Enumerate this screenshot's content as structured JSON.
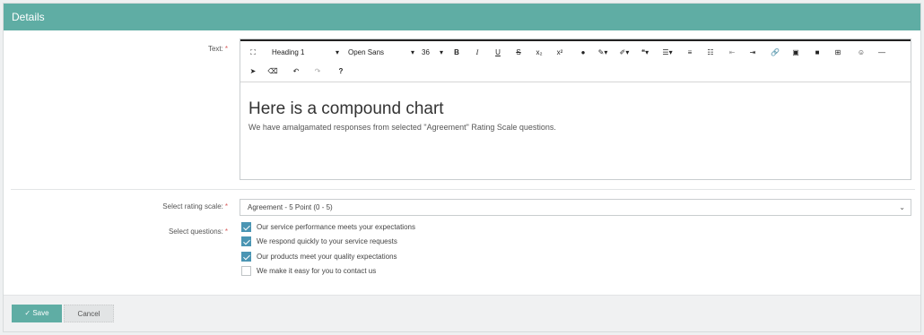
{
  "header": {
    "title": "Details"
  },
  "form": {
    "text_label": "Text:",
    "required_mark": "*",
    "rating_label": "Select rating scale:",
    "questions_label": "Select questions:"
  },
  "toolbar": {
    "fullscreen_icon": "fullscreen-icon",
    "paragraph_format": "Heading 1",
    "font_family": "Open Sans",
    "font_size": "36",
    "bold": "B",
    "italic": "I",
    "underline": "U",
    "strike": "S",
    "subscript": "x₂",
    "superscript": "x²",
    "help": "?"
  },
  "editor": {
    "heading": "Here is a compound chart",
    "body": "We have amalgamated responses from selected \"Agreement\" Rating Scale questions."
  },
  "rating_scale": {
    "selected": "Agreement - 5 Point (0 - 5)"
  },
  "questions": [
    {
      "label": "Our service performance meets your expectations",
      "checked": true
    },
    {
      "label": "We respond quickly to your service requests",
      "checked": true
    },
    {
      "label": "Our products meet your quality expectations",
      "checked": true
    },
    {
      "label": "We make it easy for you to contact us",
      "checked": false
    }
  ],
  "footer": {
    "save_label": "Save",
    "cancel_label": "Cancel"
  },
  "colors": {
    "accent": "#5fada4",
    "checkbox": "#4a95b3",
    "required": "#d95c5c"
  }
}
